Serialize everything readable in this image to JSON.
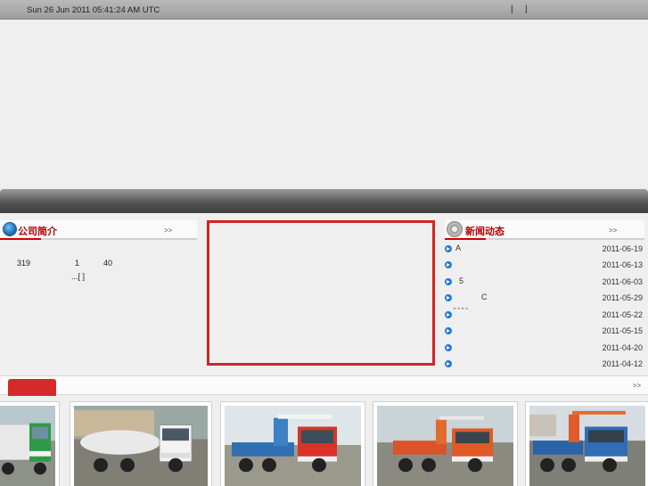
{
  "topbar": {
    "datetime": "Sun 26 Jun 2011 05:41:24 AM UTC",
    "sep1": "|",
    "sep2": "|"
  },
  "about": {
    "title": "公司简介",
    "more": ">>",
    "t1": "319",
    "t2": "1",
    "t3": "40",
    "t4": "...[ ]"
  },
  "news": {
    "title": "新闻动态",
    "more": ">>",
    "items": [
      {
        "title": "A",
        "date": "2011-06-19"
      },
      {
        "title": "",
        "date": "2011-06-13"
      },
      {
        "title": "5",
        "date": "2011-06-03"
      },
      {
        "title": "C",
        "date": "2011-05-29"
      },
      {
        "title": "\" \" \"  \"",
        "date": "2011-05-22"
      },
      {
        "title": "",
        "date": "2011-05-15"
      },
      {
        "title": "",
        "date": "2011-04-20"
      },
      {
        "title": "",
        "date": "2011-04-12"
      }
    ]
  },
  "products": {
    "more": ">>",
    "items": [
      {
        "icon": "truck-photo-green"
      },
      {
        "icon": "truck-photo-white-tanker"
      },
      {
        "icon": "truck-photo-red-crane"
      },
      {
        "icon": "truck-photo-orange-crane"
      },
      {
        "icon": "truck-photo-blue-crane"
      }
    ]
  },
  "colors": {
    "accent_red": "#d42424",
    "title_red": "#b00000",
    "bullet_blue": "#1f7ad0"
  }
}
